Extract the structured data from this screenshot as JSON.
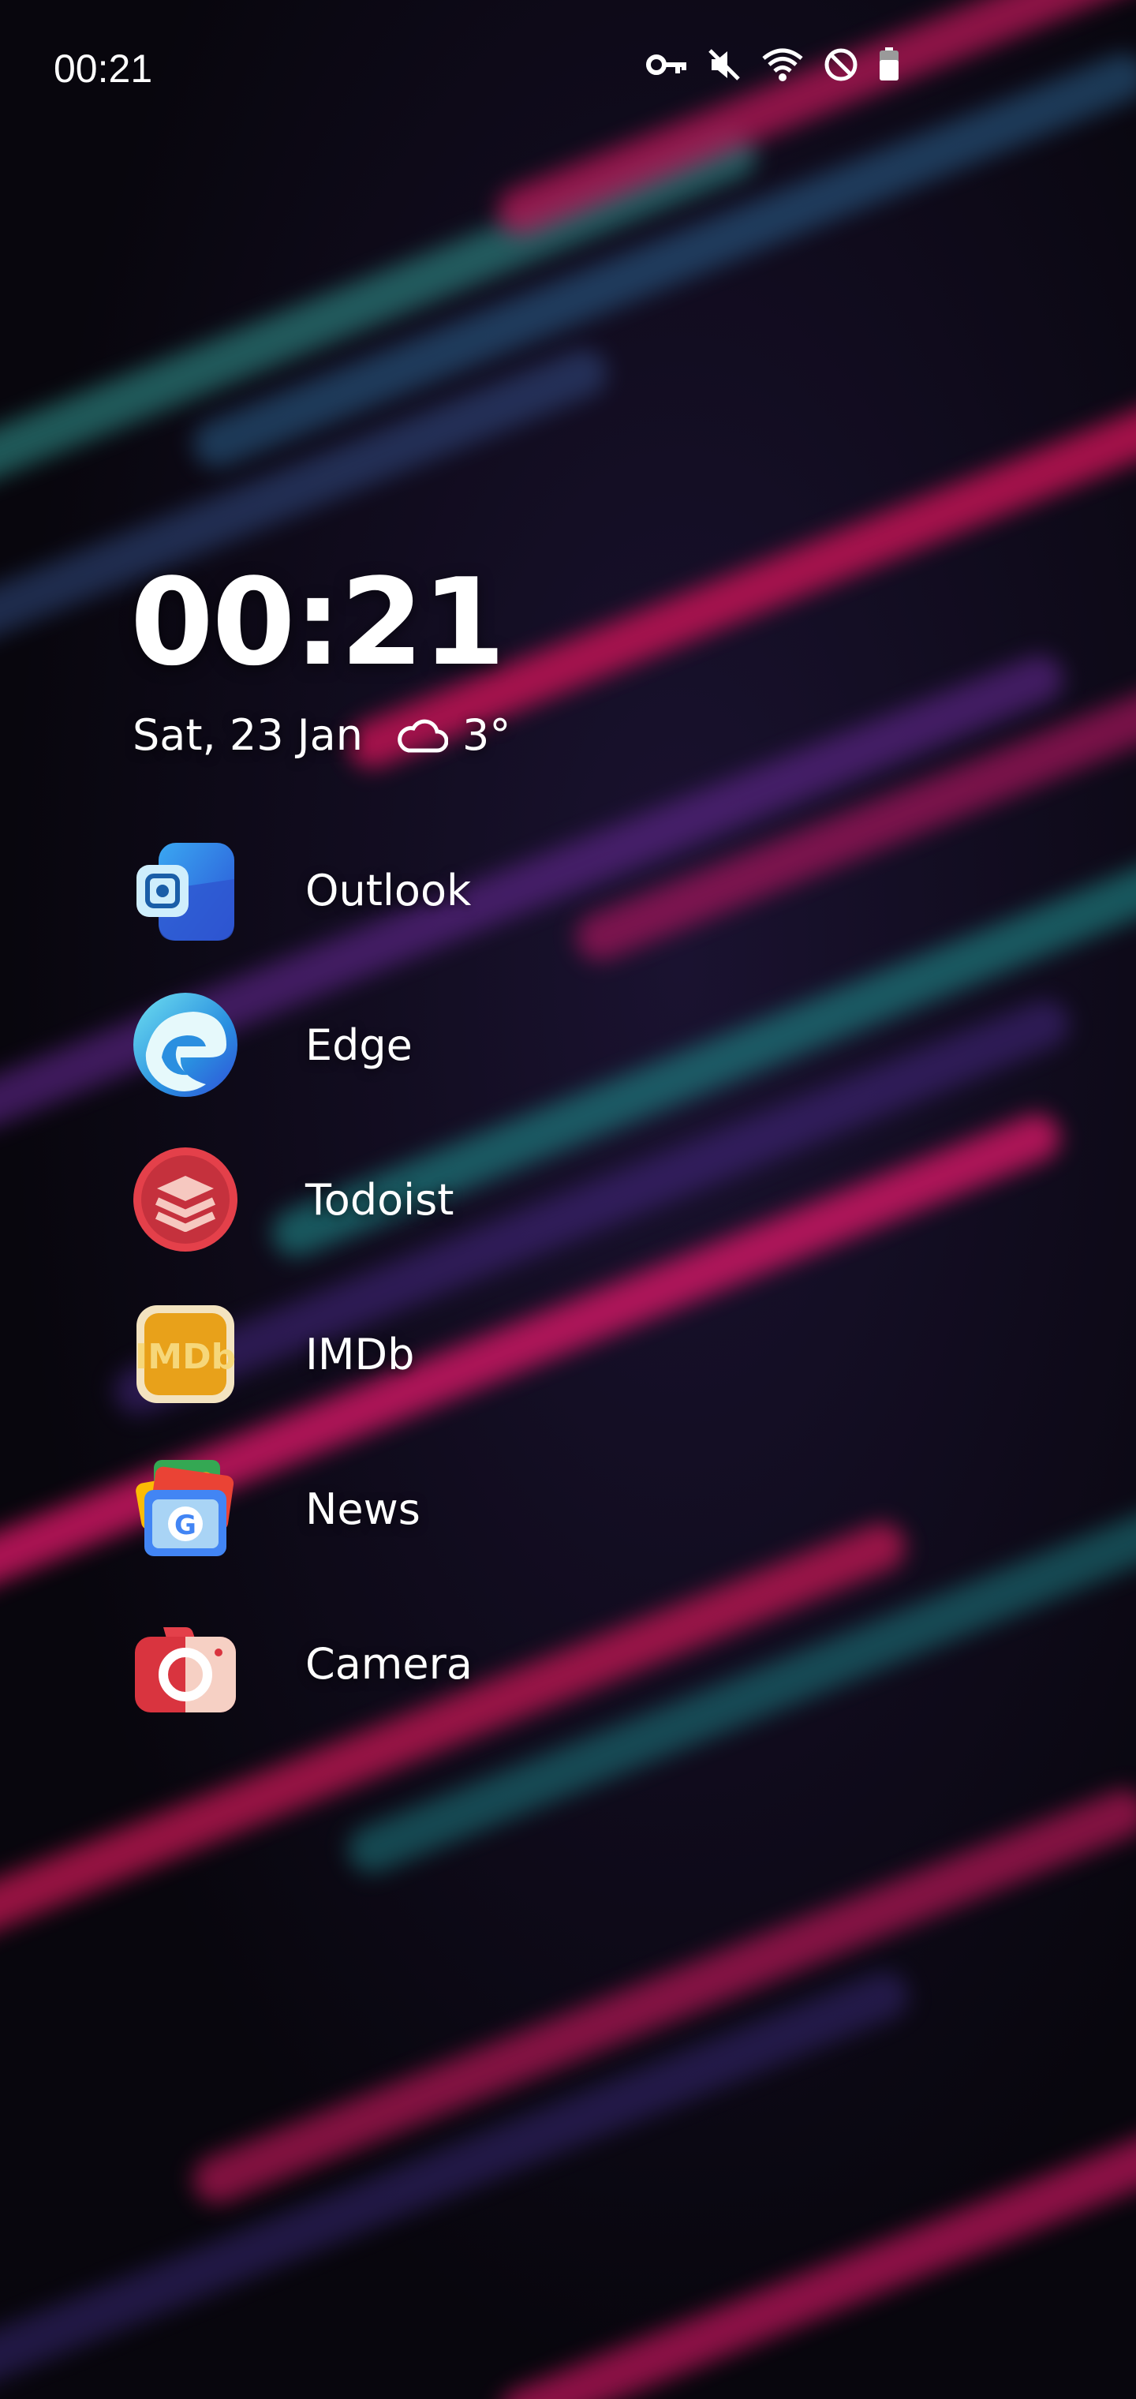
{
  "status_bar": {
    "time": "00:21",
    "icons": [
      "vpn-key-icon",
      "mute-icon",
      "wifi-icon",
      "do-not-disturb-icon",
      "battery-icon"
    ]
  },
  "home": {
    "clock": "00:21",
    "date": "Sat, 23 Jan",
    "temperature": "3°",
    "weather_icon": "cloud-icon"
  },
  "apps": [
    {
      "label": "Outlook",
      "icon": "outlook-icon"
    },
    {
      "label": "Edge",
      "icon": "edge-icon"
    },
    {
      "label": "Todoist",
      "icon": "todoist-icon"
    },
    {
      "label": "IMDb",
      "icon": "imdb-icon",
      "icon_text": "IMDb"
    },
    {
      "label": "News",
      "icon": "news-icon",
      "icon_text": "G"
    },
    {
      "label": "Camera",
      "icon": "camera-icon"
    }
  ],
  "colors": {
    "magenta": "#d4145a",
    "teal": "#2a8a95",
    "purple": "#5a2a8a",
    "background": "#06050a"
  }
}
